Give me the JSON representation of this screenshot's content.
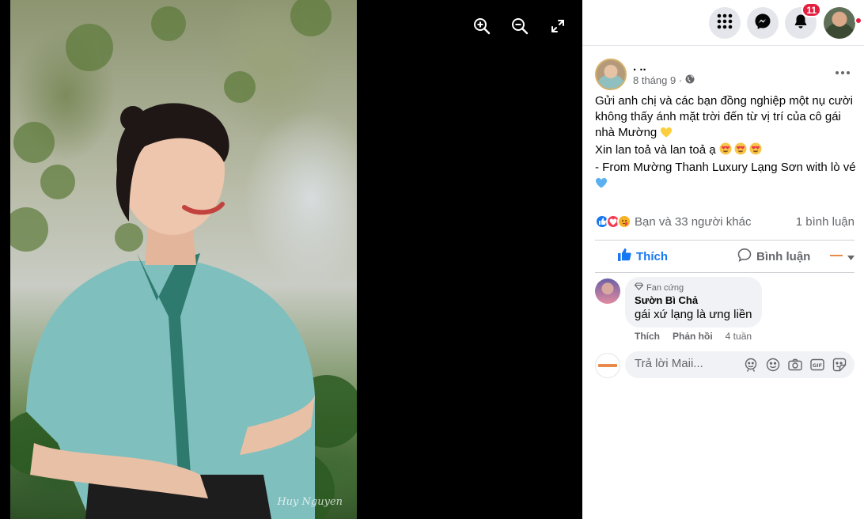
{
  "viewer": {
    "signature": "Huy Nguyen",
    "controls": [
      "zoom-in",
      "zoom-out",
      "fullscreen"
    ]
  },
  "topbar": {
    "notifications_count": "11"
  },
  "post": {
    "author": ". ..",
    "date": "8 tháng 9 ·",
    "privacy": "public",
    "text_lines": [
      "Gửi anh chị và các bạn đồng nghiệp một nụ cười không thấy ánh mặt trời đến từ vị trí của cô gái nhà Mường",
      "Xin lan toả và lan toả ạ",
      "- From Mường Thanh Luxury Lạng Sơn with lò vé"
    ],
    "reactions_text": "Bạn và 33 người khác",
    "comments_count": "1 bình luận",
    "like_label": "Thích",
    "comment_label": "Bình luận"
  },
  "comment": {
    "badge": "Fan cứng",
    "name": "Sườn Bì Chả",
    "text": "gái xứ lạng là ưng liền",
    "like": "Thích",
    "reply": "Phản hồi",
    "time": "4 tuần"
  },
  "reply_box": {
    "placeholder": "Trả lời Maii..."
  },
  "colors": {
    "accent": "#1877f2",
    "badge": "#e41e3f"
  }
}
